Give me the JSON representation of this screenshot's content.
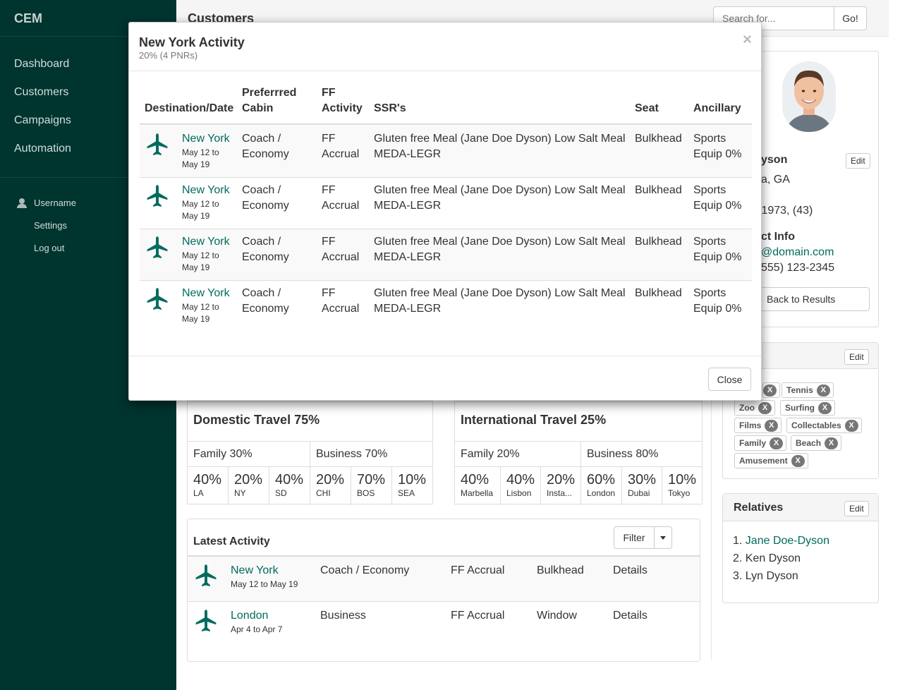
{
  "app": {
    "brand": "CEM"
  },
  "nav": {
    "items": [
      "Dashboard",
      "Customers",
      "Campaigns",
      "Automation"
    ]
  },
  "user": {
    "name": "Username",
    "settings": "Settings",
    "logout": "Log out"
  },
  "header": {
    "title": "Customers",
    "search_placeholder": "Search for...",
    "search_button": "Go!"
  },
  "profile": {
    "name_partial": "yson",
    "edit_label": "Edit",
    "location_partial": "a, GA",
    "dob_partial": "/1973, (43)",
    "contact_heading_partial": "ct Info",
    "email_partial": "@domain.com",
    "phone_partial": "555) 123-2345",
    "back_label": "Back to Results"
  },
  "interests": {
    "edit_label": "Edit",
    "tags": [
      "Tennis",
      "Zoo",
      "Surfing",
      "Films",
      "Collectables",
      "Family",
      "Beach",
      "Amusement"
    ],
    "remove_glyph": "X"
  },
  "relatives": {
    "title": "Relatives",
    "edit_label": "Edit",
    "items": [
      {
        "num": "1.",
        "name": "Jane Doe-Dyson",
        "link": true
      },
      {
        "num": "2.",
        "name": "Ken Dyson",
        "link": false
      },
      {
        "num": "3.",
        "name": "Lyn Dyson",
        "link": false
      }
    ]
  },
  "domestic": {
    "title": "Domestic Travel 75%",
    "split": [
      "Family 30%",
      "Business 70%"
    ],
    "cells": [
      {
        "value": "40%",
        "label": "LA"
      },
      {
        "value": "20%",
        "label": "NY"
      },
      {
        "value": "40%",
        "label": "SD"
      },
      {
        "value": "20%",
        "label": "CHI"
      },
      {
        "value": "70%",
        "label": "BOS"
      },
      {
        "value": "10%",
        "label": "SEA"
      }
    ]
  },
  "international": {
    "title": "International Travel 25%",
    "split": [
      "Family 20%",
      "Business 80%"
    ],
    "cells": [
      {
        "value": "40%",
        "label": "Marbella"
      },
      {
        "value": "40%",
        "label": "Lisbon"
      },
      {
        "value": "20%",
        "label": "Insta..."
      },
      {
        "value": "60%",
        "label": "London"
      },
      {
        "value": "30%",
        "label": "Dubai"
      },
      {
        "value": "10%",
        "label": "Tokyo"
      }
    ]
  },
  "latest": {
    "title": "Latest Activity",
    "filter_label": "Filter",
    "rows": [
      {
        "dest": "New York",
        "dates": "May 12 to May 19",
        "cabin": "Coach / Economy",
        "ff": "FF Accrual",
        "seat": "Bulkhead",
        "details": "Details"
      },
      {
        "dest": "London",
        "dates": "Apr 4 to Apr 7",
        "cabin": "Business",
        "ff": "FF Accrual",
        "seat": "Window",
        "details": "Details"
      }
    ]
  },
  "modal": {
    "title": "New York Activity",
    "subtitle": "20% (4 PNRs)",
    "close_glyph": "×",
    "close_label": "Close",
    "headers": {
      "dest": "Destination/Date",
      "cabin_1": "Preferrred",
      "cabin_2": "Cabin",
      "ff_1": "FF",
      "ff_2": "Activity",
      "ssr": "SSR's",
      "seat": "Seat",
      "anc": "Ancillary"
    },
    "rows": [
      {
        "dest": "New York",
        "date_1": "May 12 to",
        "date_2": "May 19",
        "cabin_1": "Coach /",
        "cabin_2": "Economy",
        "ff_1": "FF",
        "ff_2": "Accrual",
        "ssr_1": "Gluten free Meal (Jane Doe Dyson) Low Salt Meal",
        "ssr_2": "MEDA-LEGR",
        "seat": "Bulkhead",
        "anc_1": "Sports",
        "anc_2": "Equip 0%"
      },
      {
        "dest": "New York",
        "date_1": "May 12 to",
        "date_2": "May 19",
        "cabin_1": "Coach /",
        "cabin_2": "Economy",
        "ff_1": "FF",
        "ff_2": "Accrual",
        "ssr_1": "Gluten free Meal (Jane Doe Dyson) Low Salt Meal",
        "ssr_2": "MEDA-LEGR",
        "seat": "Bulkhead",
        "anc_1": "Sports",
        "anc_2": "Equip 0%"
      },
      {
        "dest": "New York",
        "date_1": "May 12 to",
        "date_2": "May 19",
        "cabin_1": "Coach /",
        "cabin_2": "Economy",
        "ff_1": "FF",
        "ff_2": "Accrual",
        "ssr_1": "Gluten free Meal (Jane Doe Dyson) Low Salt Meal",
        "ssr_2": "MEDA-LEGR",
        "seat": "Bulkhead",
        "anc_1": "Sports",
        "anc_2": "Equip 0%"
      },
      {
        "dest": "New York",
        "date_1": "May 12 to",
        "date_2": "May 19",
        "cabin_1": "Coach /",
        "cabin_2": "Economy",
        "ff_1": "FF",
        "ff_2": "Accrual",
        "ssr_1": "Gluten free Meal (Jane Doe Dyson) Low Salt Meal",
        "ssr_2": "MEDA-LEGR",
        "seat": "Bulkhead",
        "anc_1": "Sports",
        "anc_2": "Equip 0%"
      }
    ]
  },
  "colors": {
    "sidebar": "#00342f",
    "accent": "#006b5e"
  }
}
